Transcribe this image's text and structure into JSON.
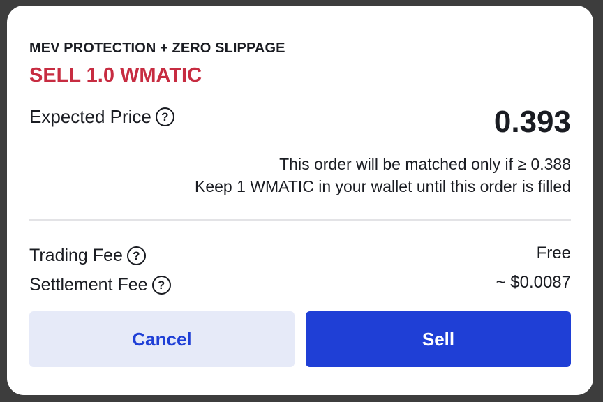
{
  "modal": {
    "subtitle": "MEV PROTECTION + ZERO SLIPPAGE",
    "title": "SELL 1.0 WMATIC",
    "title_color": "#c72c41",
    "expected_price": {
      "label": "Expected Price",
      "value": "0.393",
      "help_icon": "question-circle-icon",
      "help_glyph": "?"
    },
    "notes": [
      "This order will be matched only if ≥ 0.388",
      "Keep 1 WMATIC in your wallet until this order is filled"
    ],
    "fees": [
      {
        "label": "Trading Fee",
        "value": "Free",
        "help_glyph": "?"
      },
      {
        "label": "Settlement Fee",
        "value": "~ $0.0087",
        "help_glyph": "?"
      }
    ],
    "buttons": {
      "cancel_label": "Cancel",
      "sell_label": "Sell",
      "accent_color": "#1f3fd6"
    }
  }
}
